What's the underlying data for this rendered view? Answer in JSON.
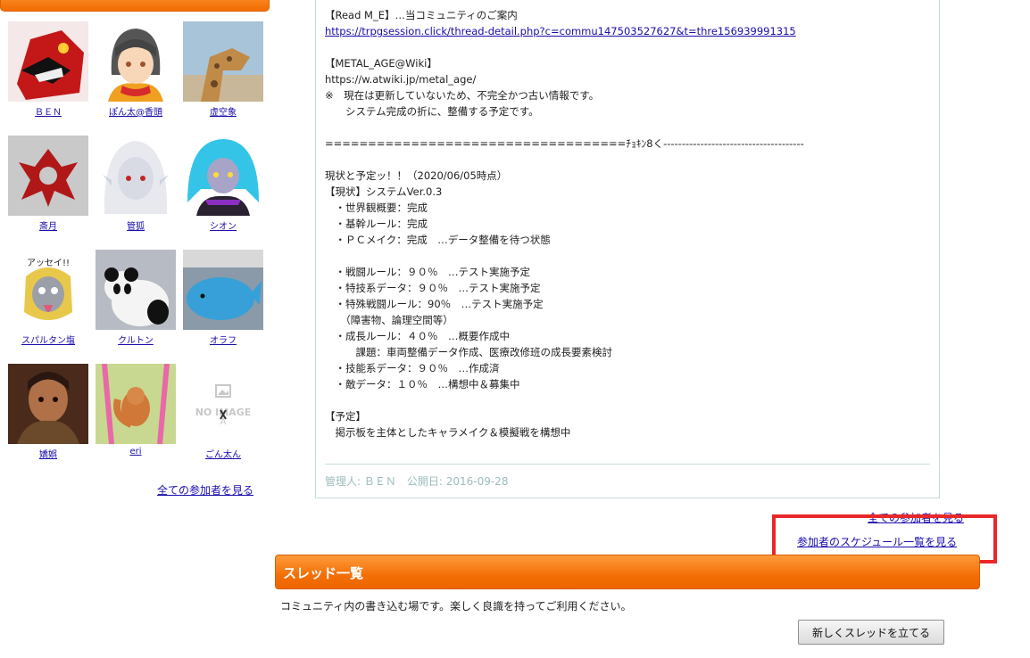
{
  "members": [
    {
      "name": "ＢＥＮ",
      "art": "robot"
    },
    {
      "name": "ぽん太@香頭",
      "art": "girl"
    },
    {
      "name": "虚空象",
      "art": "giraffe"
    },
    {
      "name": "斎月",
      "art": "emblem"
    },
    {
      "name": "管狐",
      "art": "white-hair"
    },
    {
      "name": "シオン",
      "art": "blue-hair"
    },
    {
      "name": "スパルタン塩",
      "art": "mask"
    },
    {
      "name": "クルトン",
      "art": "panda"
    },
    {
      "name": "オラフ",
      "art": "whale"
    },
    {
      "name": "嬌娯",
      "art": "warrior"
    },
    {
      "name": "eri",
      "art": "squirrel"
    },
    {
      "name": "ごん太ん",
      "art": "noimage"
    }
  ],
  "no_image_text": "NO IMAGE",
  "all_members_link": "全ての参加者を見る",
  "description": {
    "read_me_label": "【Read M_E】…当コミュニティのご案内",
    "read_me_url": "https://trpgsession.click/thread-detail.php?c=commu147503527627&t=thre156939991315",
    "wiki_label": "【METAL_AGE@Wiki】",
    "wiki_url": "https://w.atwiki.jp/metal_age/",
    "note1": "※　現在は更新していないため、不完全かつ古い情報です。",
    "note2": "　　システム完成の折に、整備する予定です。",
    "divider": "===================================ﾁｮｷﾝ8く--------------------------------------",
    "status_title": "現状と予定ッ！！（2020/06/05時点）",
    "status_header": "【現状】システムVer.0.3",
    "items": [
      "　・世界観概要：完成",
      "　・基幹ルール：完成",
      "　・ＰＣメイク：完成　…データ整備を待つ状態",
      "",
      "　・戦闘ルール：９０％　…テスト実施予定",
      "　・特技系データ：９０％　…テスト実施予定",
      "　・特殊戦闘ルール：90％　…テスト実施予定",
      "　　（障害物、論理空間等）",
      "　・成長ルール：４０％　…概要作成中",
      "　　　課題：車両整備データ作成、医療改修班の成長要素検討",
      "　・技能系データ：９０％　…作成済",
      "　・敵データ：１０％　…構想中＆募集中"
    ],
    "plan_header": "【予定】",
    "plan_text": "　掲示板を主体としたキャラメイク＆模擬戦を構想中"
  },
  "admin": "管理人: ＢＥＮ　公開日: 2016-09-28",
  "schedule_link": "参加者のスケジュール一覧を見る",
  "thread_section": {
    "title": "スレッド一覧",
    "description": "コミュニティ内の書き込む場です。楽しく良識を持ってご利用ください。",
    "new_button": "新しくスレッドを立てる"
  },
  "colors": {
    "accent": "#f26d00",
    "link": "#1a0dab",
    "highlight": "#e8282a"
  }
}
